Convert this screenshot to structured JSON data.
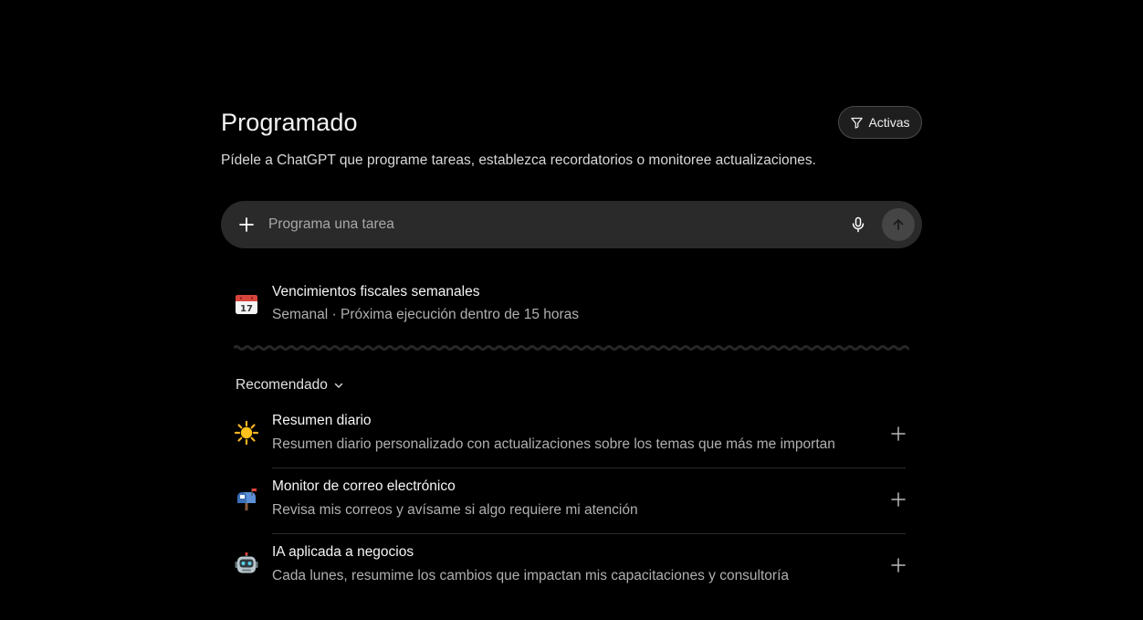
{
  "header": {
    "title": "Programado",
    "filter_label": "Activas",
    "subtitle": "Pídele a ChatGPT que programe tareas, establezca recordatorios o monitoree actualizaciones."
  },
  "composer": {
    "placeholder": "Programa una tarea"
  },
  "scheduled": [
    {
      "title": "Vencimientos fiscales semanales",
      "frequency": "Semanal",
      "separator": "·",
      "next_run": "Próxima ejecución dentro de 15 horas",
      "calendar_day": "17",
      "icon": "calendar-icon"
    }
  ],
  "recommended": {
    "label": "Recomendado",
    "items": [
      {
        "title": "Resumen diario",
        "description": "Resumen diario personalizado con actualizaciones sobre los temas que más me importan",
        "icon": "sun-icon"
      },
      {
        "title": "Monitor de correo electrónico",
        "description": "Revisa mis correos y avísame si algo requiere mi atención",
        "icon": "mailbox-icon"
      },
      {
        "title": "IA aplicada a negocios",
        "description": "Cada lunes, resumime los cambios que impactan mis capacitaciones y consultoría",
        "icon": "robot-icon"
      }
    ]
  },
  "colors": {
    "background": "#000000",
    "composer": "#2a2a2a",
    "muted_text": "#b0b0b0",
    "divider": "#2a2a2a"
  }
}
